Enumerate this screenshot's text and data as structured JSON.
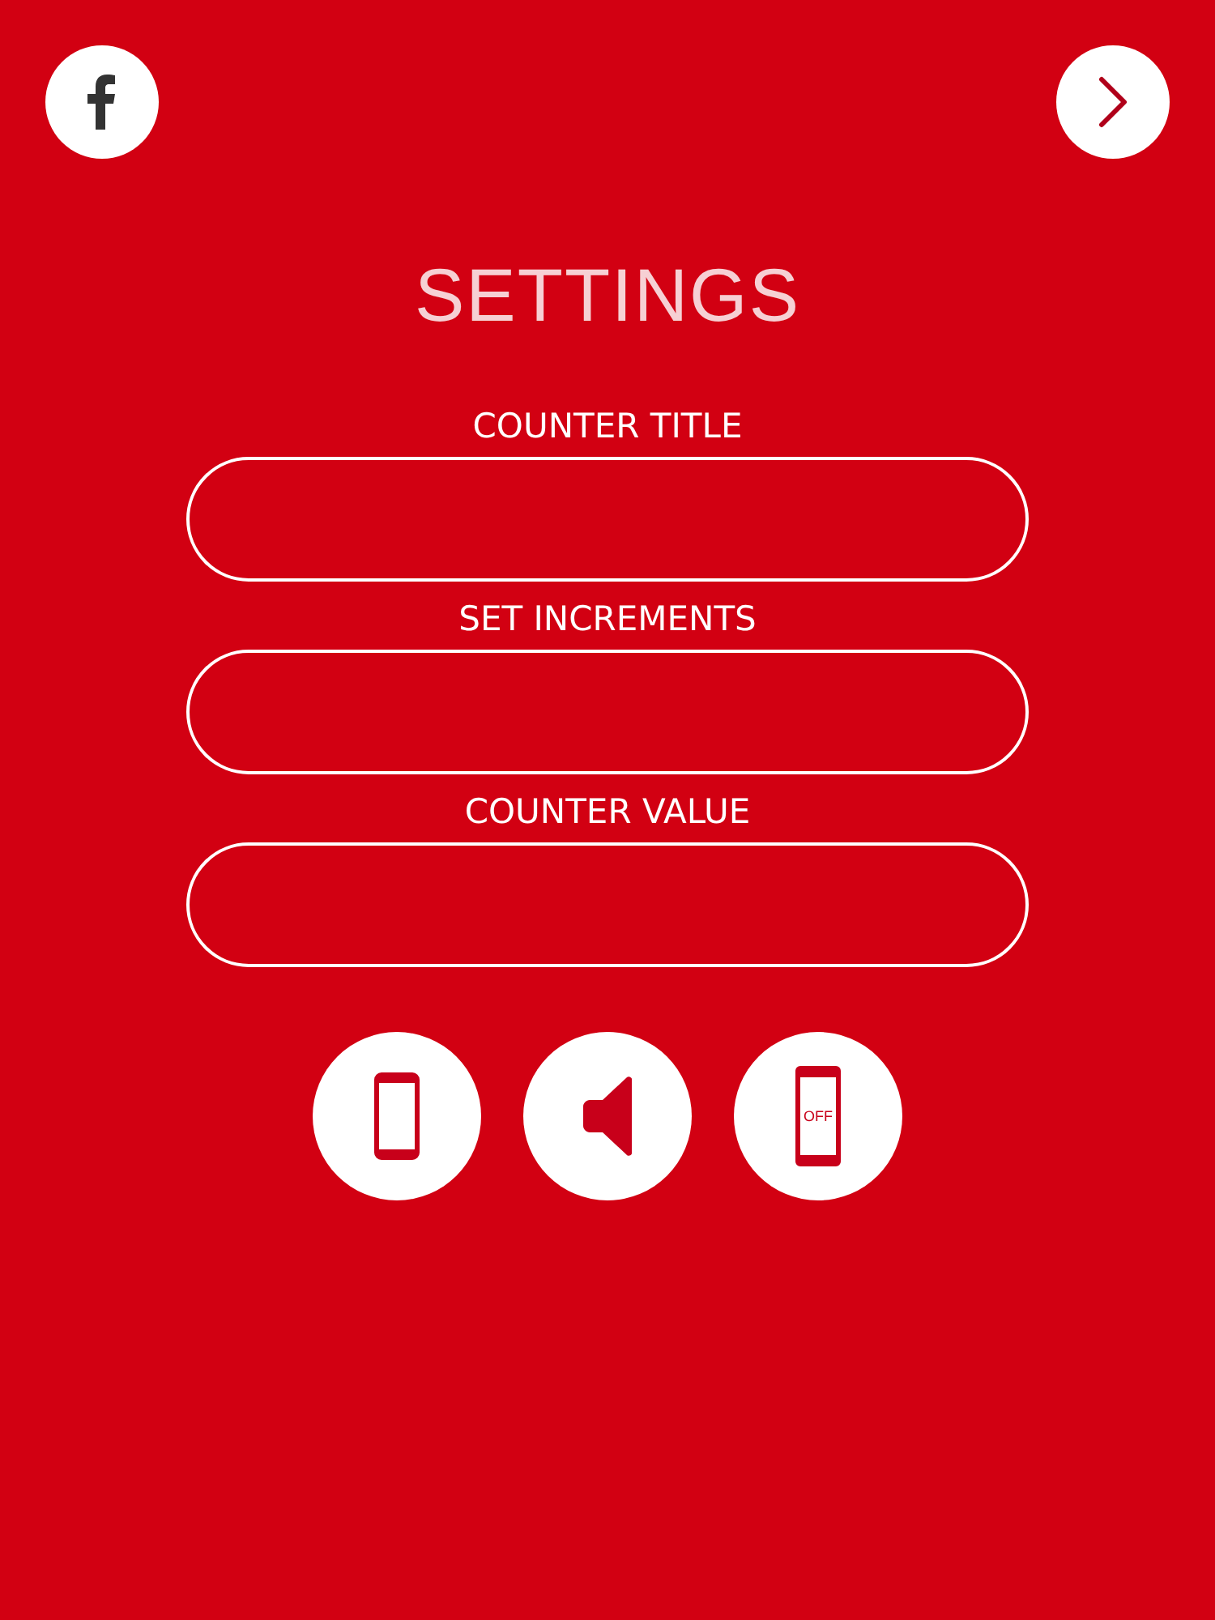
{
  "title": "SETTINGS",
  "fields": [
    {
      "label": "COUNTER TITLE"
    },
    {
      "label": "SET INCREMENTS"
    },
    {
      "label": "COUNTER VALUE"
    }
  ],
  "mode_buttons": [
    {
      "kind": "phone"
    },
    {
      "kind": "sound"
    },
    {
      "kind": "phone_off",
      "text": "OFF"
    }
  ]
}
